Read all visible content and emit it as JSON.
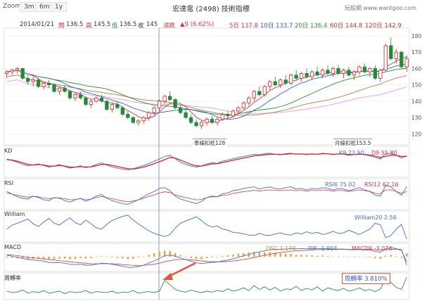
{
  "toolbar": {
    "zoom_label": "Zoom",
    "ranges": [
      "3m",
      "6m",
      "1y"
    ]
  },
  "header": {
    "title": "宏達電 (2498) 技術指標",
    "site": "玩股網 www.wantgoo.com"
  },
  "quote": {
    "date": "2014/01/21",
    "open_label": "開",
    "open": "136.5",
    "high_label": "高",
    "high": "145.5",
    "low_label": "低",
    "low": "136.5",
    "close_label": "收",
    "close": "145",
    "change_label": "漲跌",
    "change": "▲9 (6.62%)"
  },
  "ma": [
    {
      "label": "5日",
      "value": "137.8",
      "color": "#d9363e"
    },
    {
      "label": "10日",
      "value": "133.7",
      "color": "#2b5fd9"
    },
    {
      "label": "20日",
      "value": "136.4",
      "color": "#2f8f3a"
    },
    {
      "label": "60日",
      "value": "144.8",
      "color": "#c0392b"
    },
    {
      "label": "120日",
      "value": "142.9",
      "color": "#c0392b"
    }
  ],
  "annotations": {
    "season_line": "季線扣抵128",
    "month_line": "月線扣抵153.5"
  },
  "panels": {
    "kd": {
      "label": "KD",
      "k_text": "K9 72.50",
      "d_text": "D9 55.80"
    },
    "rsi": {
      "label": "RSI",
      "rsi6_text": "RSI6 75.02",
      "rsi12_text": "RSI12 62.16"
    },
    "william": {
      "label": "William",
      "value_text": "William20 2.56"
    },
    "macd": {
      "label": "MACD",
      "osc_text": "OSC 1.170",
      "dif_text": "DIF -1.904",
      "macd9_text": "MACD9 -3.074"
    },
    "turnover": {
      "label": "周轉率",
      "value_text": "周轉率 3.810%"
    }
  },
  "colors": {
    "up": "#e02020",
    "down": "#1f8a3a",
    "k_line": "#3b6fd8",
    "d_line": "#e02020",
    "william_line": "#3b6fd8",
    "turnover_line": "#2f8f3a",
    "highlight": "#e8533f"
  },
  "chart_data": {
    "type": "candlestick",
    "y_ticks": [
      120,
      130,
      140,
      150,
      160,
      170,
      180
    ],
    "ylim": [
      115,
      183
    ],
    "candles": [
      [
        157,
        159,
        154,
        158
      ],
      [
        158,
        160,
        156,
        159
      ],
      [
        159,
        161,
        157,
        160
      ],
      [
        160,
        160,
        153,
        154
      ],
      [
        154,
        156,
        150,
        152
      ],
      [
        152,
        155,
        149,
        153
      ],
      [
        153,
        154,
        148,
        149
      ],
      [
        149,
        152,
        147,
        151
      ],
      [
        151,
        153,
        148,
        150
      ],
      [
        150,
        151,
        145,
        146
      ],
      [
        146,
        149,
        144,
        148
      ],
      [
        148,
        150,
        145,
        146
      ],
      [
        146,
        147,
        141,
        142
      ],
      [
        142,
        145,
        140,
        144
      ],
      [
        144,
        146,
        141,
        142
      ],
      [
        142,
        143,
        137,
        138
      ],
      [
        138,
        141,
        136,
        140
      ],
      [
        140,
        143,
        139,
        142
      ],
      [
        142,
        144,
        139,
        140
      ],
      [
        140,
        141,
        134,
        135
      ],
      [
        135,
        139,
        133,
        138
      ],
      [
        138,
        140,
        135,
        136
      ],
      [
        136,
        137,
        131,
        132
      ],
      [
        132,
        134,
        129,
        130
      ],
      [
        130,
        131,
        126,
        127
      ],
      [
        127,
        129,
        125,
        128
      ],
      [
        128,
        131,
        126,
        130
      ],
      [
        130,
        134,
        128,
        133
      ],
      [
        133,
        137,
        131,
        136
      ],
      [
        136,
        141,
        134,
        140
      ],
      [
        140,
        144,
        138,
        143
      ],
      [
        143,
        146,
        140,
        141
      ],
      [
        141,
        142,
        135,
        136
      ],
      [
        136,
        138,
        132,
        133
      ],
      [
        133,
        135,
        129,
        130
      ],
      [
        130,
        132,
        126,
        127
      ],
      [
        127,
        129,
        124,
        125
      ],
      [
        125,
        128,
        123,
        127
      ],
      [
        127,
        130,
        125,
        129
      ],
      [
        129,
        131,
        126,
        127
      ],
      [
        127,
        130,
        125,
        129
      ],
      [
        129,
        133,
        128,
        132
      ],
      [
        132,
        134,
        129,
        131
      ],
      [
        131,
        135,
        130,
        134
      ],
      [
        134,
        137,
        132,
        136
      ],
      [
        136,
        140,
        135,
        139
      ],
      [
        139,
        143,
        137,
        142
      ],
      [
        142,
        147,
        140,
        146
      ],
      [
        146,
        149,
        143,
        144
      ],
      [
        144,
        150,
        143,
        149
      ],
      [
        149,
        153,
        147,
        152
      ],
      [
        152,
        155,
        149,
        150
      ],
      [
        150,
        154,
        148,
        153
      ],
      [
        153,
        156,
        150,
        151
      ],
      [
        151,
        157,
        150,
        156
      ],
      [
        156,
        159,
        153,
        154
      ],
      [
        154,
        158,
        152,
        157
      ],
      [
        157,
        160,
        154,
        155
      ],
      [
        155,
        159,
        153,
        158
      ],
      [
        158,
        161,
        155,
        156
      ],
      [
        156,
        160,
        154,
        159
      ],
      [
        159,
        162,
        156,
        157
      ],
      [
        157,
        161,
        155,
        160
      ],
      [
        160,
        162,
        156,
        157
      ],
      [
        157,
        160,
        154,
        159
      ],
      [
        159,
        161,
        155,
        156
      ],
      [
        156,
        159,
        153,
        158
      ],
      [
        158,
        162,
        156,
        161
      ],
      [
        161,
        163,
        157,
        158
      ],
      [
        158,
        161,
        155,
        160
      ],
      [
        160,
        162,
        153,
        154
      ],
      [
        154,
        160,
        152,
        159
      ],
      [
        159,
        175,
        158,
        174
      ],
      [
        174,
        179,
        165,
        166
      ],
      [
        166,
        172,
        163,
        170
      ],
      [
        170,
        171,
        160,
        161
      ],
      [
        161,
        168,
        158,
        166
      ]
    ],
    "kd": {
      "k": [
        60,
        55,
        48,
        40,
        35,
        38,
        42,
        36,
        30,
        34,
        40,
        32,
        26,
        30,
        35,
        28,
        32,
        40,
        46,
        38,
        30,
        26,
        22,
        20,
        24,
        30,
        36,
        44,
        52,
        60,
        70,
        74,
        62,
        48,
        40,
        34,
        30,
        34,
        42,
        46,
        44,
        52,
        56,
        62,
        66,
        70,
        74,
        78,
        76,
        80,
        82,
        78,
        76,
        80,
        82,
        78,
        80,
        76,
        80,
        78,
        82,
        80,
        76,
        80,
        78,
        74,
        78,
        80,
        76,
        72,
        66,
        60,
        80,
        82,
        74,
        64,
        72
      ],
      "d": [
        58,
        56,
        52,
        46,
        40,
        38,
        40,
        38,
        34,
        34,
        36,
        34,
        30,
        30,
        32,
        30,
        31,
        35,
        40,
        40,
        36,
        32,
        28,
        24,
        23,
        26,
        30,
        36,
        43,
        50,
        58,
        66,
        64,
        56,
        48,
        40,
        35,
        34,
        38,
        42,
        43,
        47,
        51,
        56,
        60,
        64,
        68,
        72,
        74,
        76,
        78,
        78,
        77,
        78,
        80,
        79,
        79,
        78,
        79,
        78,
        80,
        80,
        78,
        79,
        79,
        77,
        77,
        78,
        77,
        75,
        71,
        66,
        70,
        74,
        74,
        70,
        70
      ]
    },
    "rsi": {
      "rsi6": [
        62,
        55,
        48,
        44,
        42,
        50,
        46,
        40,
        38,
        46,
        44,
        38,
        34,
        40,
        44,
        36,
        42,
        50,
        54,
        44,
        38,
        34,
        30,
        28,
        34,
        40,
        48,
        56,
        62,
        70,
        72,
        64,
        50,
        42,
        38,
        34,
        30,
        36,
        46,
        50,
        48,
        56,
        58,
        64,
        66,
        70,
        72,
        74,
        68,
        72,
        74,
        70,
        68,
        72,
        74,
        68,
        70,
        66,
        70,
        68,
        72,
        70,
        66,
        70,
        68,
        64,
        68,
        72,
        66,
        62,
        52,
        50,
        78,
        74,
        62,
        52,
        75
      ],
      "rsi12": [
        58,
        55,
        52,
        49,
        47,
        49,
        48,
        45,
        43,
        45,
        45,
        43,
        40,
        41,
        43,
        40,
        42,
        46,
        49,
        46,
        43,
        40,
        37,
        35,
        37,
        40,
        44,
        49,
        53,
        58,
        61,
        59,
        53,
        49,
        46,
        43,
        40,
        41,
        46,
        48,
        48,
        52,
        53,
        57,
        59,
        62,
        63,
        65,
        63,
        65,
        66,
        65,
        64,
        65,
        66,
        64,
        65,
        63,
        65,
        64,
        66,
        65,
        63,
        65,
        64,
        62,
        64,
        66,
        64,
        62,
        57,
        56,
        66,
        66,
        62,
        57,
        62
      ]
    },
    "william": [
      40,
      55,
      62,
      70,
      78,
      60,
      50,
      66,
      80,
      62,
      55,
      70,
      82,
      64,
      56,
      74,
      60,
      45,
      40,
      58,
      72,
      80,
      88,
      92,
      74,
      60,
      46,
      34,
      24,
      18,
      12,
      20,
      44,
      62,
      70,
      78,
      86,
      72,
      56,
      48,
      52,
      40,
      36,
      28,
      26,
      22,
      18,
      16,
      24,
      18,
      16,
      22,
      26,
      20,
      18,
      26,
      22,
      30,
      24,
      28,
      20,
      24,
      32,
      24,
      26,
      36,
      28,
      20,
      30,
      40,
      62,
      56,
      8,
      16,
      40,
      58,
      3
    ],
    "macd": {
      "dif": [
        0.5,
        0.2,
        -0.2,
        -0.6,
        -1.0,
        -1.2,
        -1.3,
        -1.6,
        -2.0,
        -2.1,
        -2.1,
        -2.3,
        -2.7,
        -2.8,
        -2.7,
        -3.0,
        -3.0,
        -2.7,
        -2.3,
        -2.4,
        -2.7,
        -3.0,
        -3.4,
        -3.8,
        -3.8,
        -3.5,
        -3.0,
        -2.3,
        -1.5,
        -0.6,
        0.3,
        0.6,
        0.2,
        -0.5,
        -1.0,
        -1.6,
        -2.2,
        -2.4,
        -2.2,
        -2.0,
        -1.9,
        -1.5,
        -1.2,
        -0.7,
        -0.2,
        0.3,
        0.8,
        1.4,
        1.7,
        2.1,
        2.5,
        2.6,
        2.7,
        2.7,
        2.9,
        2.8,
        2.9,
        2.8,
        2.9,
        2.8,
        2.9,
        2.8,
        2.7,
        2.7,
        2.7,
        2.5,
        2.5,
        2.6,
        2.5,
        2.4,
        1.9,
        1.6,
        2.8,
        3.2,
        2.9,
        2.2,
        -1.9
      ],
      "macd9": [
        0.8,
        0.6,
        0.4,
        0.1,
        -0.2,
        -0.4,
        -0.6,
        -0.8,
        -1.0,
        -1.2,
        -1.4,
        -1.6,
        -1.8,
        -2.0,
        -2.2,
        -2.3,
        -2.5,
        -2.5,
        -2.5,
        -2.5,
        -2.5,
        -2.6,
        -2.8,
        -2.9,
        -3.1,
        -3.2,
        -3.1,
        -2.9,
        -2.7,
        -2.3,
        -1.8,
        -1.4,
        -1.1,
        -1.0,
        -1.0,
        -1.1,
        -1.3,
        -1.5,
        -1.7,
        -1.8,
        -1.8,
        -1.8,
        -1.7,
        -1.5,
        -1.3,
        -1.0,
        -0.7,
        -0.3,
        0.1,
        0.5,
        0.9,
        1.2,
        1.5,
        1.7,
        1.9,
        2.1,
        2.2,
        2.3,
        2.4,
        2.5,
        2.5,
        2.6,
        2.6,
        2.6,
        2.6,
        2.6,
        2.6,
        2.6,
        2.6,
        2.6,
        2.5,
        2.4,
        2.4,
        2.6,
        2.7,
        2.6,
        -3.1
      ]
    },
    "turnover": [
      1.2,
      0.9,
      1.0,
      1.4,
      0.8,
      1.1,
      0.9,
      1.3,
      0.8,
      1.0,
      1.2,
      0.7,
      1.1,
      0.9,
      1.0,
      1.3,
      0.8,
      1.1,
      1.0,
      0.9,
      1.2,
      0.8,
      1.0,
      0.9,
      1.3,
      0.8,
      1.0,
      1.1,
      0.9,
      1.2,
      3.2,
      2.4,
      1.5,
      1.2,
      1.0,
      1.4,
      1.1,
      0.9,
      1.2,
      1.0,
      1.3,
      1.1,
      1.6,
      1.2,
      1.4,
      1.8,
      1.3,
      2.2,
      1.5,
      2.0,
      1.4,
      1.9,
      1.2,
      1.6,
      1.5,
      2.1,
      1.3,
      1.7,
      1.4,
      2.0,
      1.2,
      1.8,
      1.5,
      1.3,
      1.7,
      1.2,
      1.4,
      1.8,
      1.3,
      1.5,
      1.1,
      1.6,
      3.5,
      2.8,
      1.9,
      1.5,
      3.81
    ]
  }
}
